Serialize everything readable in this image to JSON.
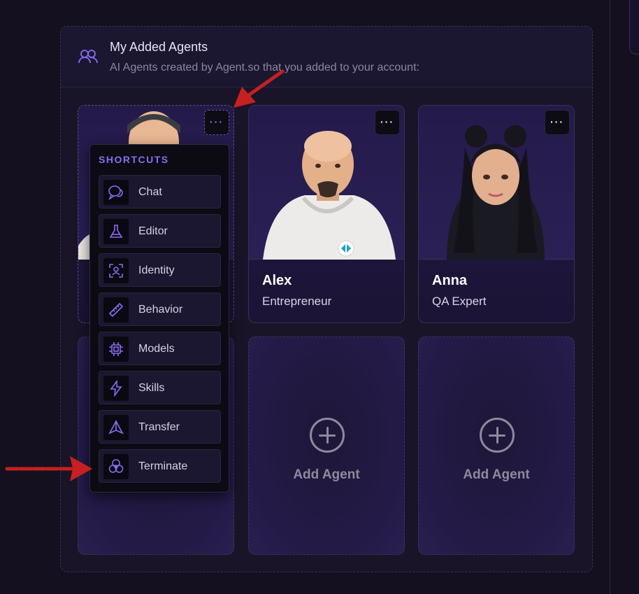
{
  "panel": {
    "title": "My Added Agents",
    "subtitle": "AI Agents created by Agent.so that you added to your account:",
    "icon": "users-icon"
  },
  "agents": [
    {
      "name": "",
      "role": "",
      "more_label": "···",
      "menu_open": true
    },
    {
      "name": "Alex",
      "role": "Entrepreneur",
      "more_label": "···"
    },
    {
      "name": "Anna",
      "role": "QA Expert",
      "more_label": "···"
    }
  ],
  "add_cards": [
    {
      "label": "Add Agent"
    },
    {
      "label": "Add Agent"
    }
  ],
  "shortcuts": {
    "title": "SHORTCUTS",
    "items": [
      {
        "label": "Chat",
        "icon": "chat-bubbles-icon"
      },
      {
        "label": "Editor",
        "icon": "flask-icon"
      },
      {
        "label": "Identity",
        "icon": "identity-scan-icon"
      },
      {
        "label": "Behavior",
        "icon": "ruler-icon"
      },
      {
        "label": "Models",
        "icon": "cpu-chip-icon"
      },
      {
        "label": "Skills",
        "icon": "lightning-icon"
      },
      {
        "label": "Transfer",
        "icon": "navigation-triangle-icon"
      },
      {
        "label": "Terminate",
        "icon": "biohazard-icon"
      }
    ]
  },
  "colors": {
    "accent": "#8b6cf6",
    "annotation_arrow": "#c62020"
  }
}
